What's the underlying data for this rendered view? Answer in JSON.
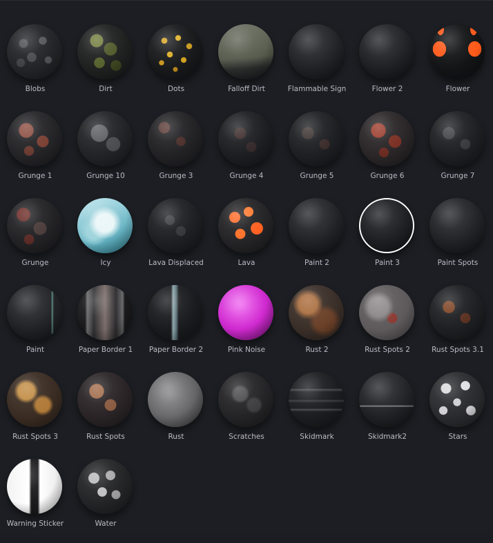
{
  "materials": [
    {
      "label": "Blobs",
      "bg": "radial-gradient(circle at 30% 35%, #4b4c50 0 8%, transparent 9%), radial-gradient(circle at 65% 30%, #55565a 0 7%, transparent 8%), radial-gradient(circle at 45% 60%, #4a4a4e 0 10%, transparent 11%), radial-gradient(circle at 75% 65%, #505054 0 6%, transparent 7%), radial-gradient(circle at 25% 70%, #3f4044 0 7%, transparent 8%), #232427"
    },
    {
      "label": "Dirt",
      "bg": "radial-gradient(circle at 35% 30%, #6f7a3a 0 12%, transparent 13%), radial-gradient(circle at 60% 45%, #4f5a2a 0 14%, transparent 15%), radial-gradient(circle at 40% 70%, #55612c 0 10%, transparent 11%), radial-gradient(circle at 70% 75%, #3c4420 0 9%, transparent 10%), #1f2020"
    },
    {
      "label": "Dots",
      "bg": "radial-gradient(circle at 30% 30%, #d4a020 0 5%, transparent 6%), radial-gradient(circle at 55% 25%, #e0b02a 0 5%, transparent 6%), radial-gradient(circle at 75% 40%, #c99a22 0 5%, transparent 6%), radial-gradient(circle at 40% 55%, #dcae28 0 6%, transparent 7%), radial-gradient(circle at 65% 65%, #d0a020 0 5%, transparent 6%), radial-gradient(circle at 25% 70%, #c8961e 0 4%, transparent 5%), radial-gradient(circle at 50% 82%, #b8881c 0 4%, transparent 5%), #18191b"
    },
    {
      "label": "Falloff Dirt",
      "bg": "linear-gradient(175deg, #6c7062 0%, #555a4c 60%, #2b2c2c 78%, #1f2022 100%)"
    },
    {
      "label": "Flammable Sign",
      "bg": "radial-gradient(circle at 50% 30%, #2a2b2f 0%, #1a1b1e 100%)"
    },
    {
      "label": "Flower 2",
      "bg": "radial-gradient(circle at 50% 30%, #28292d 0%, #18191c 100%)"
    },
    {
      "label": "Flower",
      "bg": "radial-gradient(ellipse 12% 14% at 18% 45%, #ff5a1a 0 100%, transparent 101%), radial-gradient(ellipse 12% 14% at 82% 45%, #ff5a1a 0 100%, transparent 101%), radial-gradient(ellipse 6% 10% at 20% 10%, #ff5a1a 0 100%, transparent 101%), radial-gradient(ellipse 6% 10% at 80% 10%, #ff5a1a 0 100%, transparent 101%), #131416"
    },
    {
      "label": "Grunge 1",
      "bg": "radial-gradient(circle at 35% 35%, #8a4b3e 0 14%, transparent 15%), radial-gradient(circle at 65% 55%, #7a3f33 0 12%, transparent 13%), radial-gradient(circle at 40% 72%, #6a3a30 0 9%, transparent 10%), #242427"
    },
    {
      "label": "Grunge 10",
      "bg": "radial-gradient(circle at 40% 40%, #5b5c60 0 18%, transparent 19%), radial-gradient(circle at 65% 60%, #4a4b4f 0 14%, transparent 15%), #222326"
    },
    {
      "label": "Grunge 3",
      "bg": "radial-gradient(circle at 30% 30%, #5a3a35 0 10%, transparent 11%), radial-gradient(circle at 60% 55%, #4a2e2a 0 10%, transparent 11%), #222225"
    },
    {
      "label": "Grunge 4",
      "bg": "radial-gradient(circle at 40% 40%, #3a2a28 0 12%, transparent 13%), radial-gradient(circle at 60% 65%, #35282a 0 10%, transparent 11%), #1d1e21"
    },
    {
      "label": "Grunge 5",
      "bg": "radial-gradient(circle at 35% 40%, #3b3230 0 12%, transparent 13%), radial-gradient(circle at 65% 60%, #3a2c2a 0 10%, transparent 11%), #1e1f22"
    },
    {
      "label": "Grunge 6",
      "bg": "radial-gradient(circle at 35% 35%, #9a3a2a 0 14%, transparent 15%), radial-gradient(circle at 65% 55%, #7a2f22 0 13%, transparent 14%), radial-gradient(circle at 45% 75%, #6a2a20 0 9%, transparent 10%), #2a2628"
    },
    {
      "label": "Grunge 7",
      "bg": "radial-gradient(circle at 35% 40%, #3e3f43 0 12%, transparent 13%), radial-gradient(circle at 65% 60%, #38393d 0 10%, transparent 11%), #1e1f22"
    },
    {
      "label": "Grunge",
      "bg": "radial-gradient(circle at 30% 30%, #6a2a25 0 12%, transparent 13%), radial-gradient(circle at 60% 55%, #4a3a3a 0 14%, transparent 15%), radial-gradient(circle at 40% 75%, #5a2a25 0 9%, transparent 10%), #222225"
    },
    {
      "label": "Icy",
      "bg": "radial-gradient(circle at 50% 45%, #e9f6f8 0 22%, transparent 40%), radial-gradient(circle at 30% 60%, #9fd4dc 0 15%, transparent 30%), linear-gradient(160deg, #bfe6ee 0%, #6cb7c6 60%, #3a8fa0 100%)"
    },
    {
      "label": "Lava Displaced",
      "bg": "radial-gradient(circle at 40% 40%, #3a3b3e 0 10%, transparent 11%), radial-gradient(circle at 60% 60%, #343538 0 10%, transparent 11%), #1e1f22"
    },
    {
      "label": "Lava",
      "bg": "radial-gradient(circle at 30% 35%, #ff6b2a 0 10%, transparent 11%), radial-gradient(circle at 55% 25%, #ff7a30 0 9%, transparent 10%), radial-gradient(circle at 70% 55%, #ff6020 0 12%, transparent 13%), radial-gradient(circle at 40% 65%, #ff7028 0 10%, transparent 11%), #242426"
    },
    {
      "label": "Paint 2",
      "bg": "radial-gradient(circle at 50% 30%, #2a2b2f 0%, #1a1b1e 100%)"
    },
    {
      "label": "Paint 3",
      "bg": "radial-gradient(circle at 50% 30%, #25262a 0%, #18191c 100%)",
      "ring": true
    },
    {
      "label": "Paint Spots",
      "bg": "radial-gradient(circle at 50% 30%, #2a2b2f 0%, #1a1b1e 100%)"
    },
    {
      "label": "Paint",
      "bg": "linear-gradient(90deg, transparent 80%, #5c8a82 82%, transparent 85%), radial-gradient(circle at 50% 30%, #2a2b2f 0%, #1a1b1e 100%)"
    },
    {
      "label": "Paper Border 1",
      "bg": "linear-gradient(90deg, #1a1a1c 0%, #1a1a1c 14%, #6a6a6c 18%, #2c2c2e 30%, #7a6c6a 50%, #2c2c2e 70%, #6a6a6c 82%, #1a1a1c 86%)"
    },
    {
      "label": "Paper Border 2",
      "bg": "linear-gradient(90deg, #1a1b1e 0%, #1a1b1e 42%, #8ea6ac 46%, #5a7076 52%, #1a1b1e 56%)"
    },
    {
      "label": "Pink Noise",
      "bg": "radial-gradient(circle at 40% 35%, #f06cf0 0%, #d02ad0 50%, #8a168a 100%)"
    },
    {
      "label": "Rust 2",
      "bg": "radial-gradient(circle at 35% 35%, #a86a3a 0 18%, transparent 30%), radial-gradient(circle at 65% 65%, #6a4028 0 20%, transparent 32%), #3a2e28"
    },
    {
      "label": "Rust Spots 2",
      "bg": "radial-gradient(circle at 35% 40%, #8a8688 0 20%, transparent 32%), radial-gradient(circle at 60% 60%, #8a3a32 0 10%, transparent 12%), #5e5a5c"
    },
    {
      "label": "Rust Spots 3.1",
      "bg": "radial-gradient(circle at 35% 40%, #7a4020 0 12%, transparent 13%), radial-gradient(circle at 65% 60%, #5a3020 0 10%, transparent 11%), #1e1f22"
    },
    {
      "label": "Rust Spots 3",
      "bg": "radial-gradient(circle at 35% 35%, #c08a40 0 16%, transparent 24%), radial-gradient(circle at 65% 60%, #b07a38 0 14%, transparent 22%), #3a2c22"
    },
    {
      "label": "Rust Spots",
      "bg": "radial-gradient(circle at 35% 35%, #a06a48 0 14%, transparent 15%), radial-gradient(circle at 60% 60%, #8a5a40 0 12%, transparent 13%), #2a2426"
    },
    {
      "label": "Rust",
      "bg": "radial-gradient(circle at 40% 40%, #8a8a8c 0%, #5a5a5c 70%, #3a3a3c 100%)"
    },
    {
      "label": "Scratches",
      "bg": "radial-gradient(circle at 40% 40%, #4a4a4c 0 14%, transparent 20%), radial-gradient(circle at 65% 60%, #3e3e40 0 12%, transparent 18%), #242426"
    },
    {
      "label": "Skidmark",
      "bg": "linear-gradient(180deg, transparent 30%, #4a4b4f 32%, transparent 36%, transparent 50%, #3e3f43 52%, transparent 56%, transparent 66%, #4a4b4f 68%, transparent 72%), #1c1d20"
    },
    {
      "label": "Skidmark2",
      "bg": "linear-gradient(180deg, transparent 60%, #8a8c90 62%, transparent 64%), radial-gradient(circle at 50% 30%, #2a2b2f 0%, #1a1b1e 100%)"
    },
    {
      "label": "Stars",
      "bg": "radial-gradient(circle at 30% 30%, #d8d8da 0 9%, transparent 10%), radial-gradient(circle at 65% 25%, #e0e0e2 0 8%, transparent 9%), radial-gradient(circle at 50% 55%, #cfcfd1 0 9%, transparent 10%), radial-gradient(circle at 25% 70%, #d0d0d2 0 7%, transparent 8%), radial-gradient(circle at 75% 70%, #c8c8ca 0 8%, transparent 9%), #2a2b2e"
    },
    {
      "label": "Warning Sticker",
      "bg": "linear-gradient(90deg, #f2f2f2 0%, #ffffff 40%, #1a1a1c 44%, #1a1a1c 56%, #ffffff 60%, #e8e8e8 100%)"
    },
    {
      "label": "Water",
      "bg": "radial-gradient(circle at 30% 35%, #b8b8ba 0 10%, transparent 11%), radial-gradient(circle at 60% 30%, #a8a8aa 0 9%, transparent 10%), radial-gradient(circle at 45% 60%, #c0c0c2 0 10%, transparent 11%), radial-gradient(circle at 70% 65%, #9a9a9c 0 8%, transparent 9%), #232426"
    }
  ]
}
